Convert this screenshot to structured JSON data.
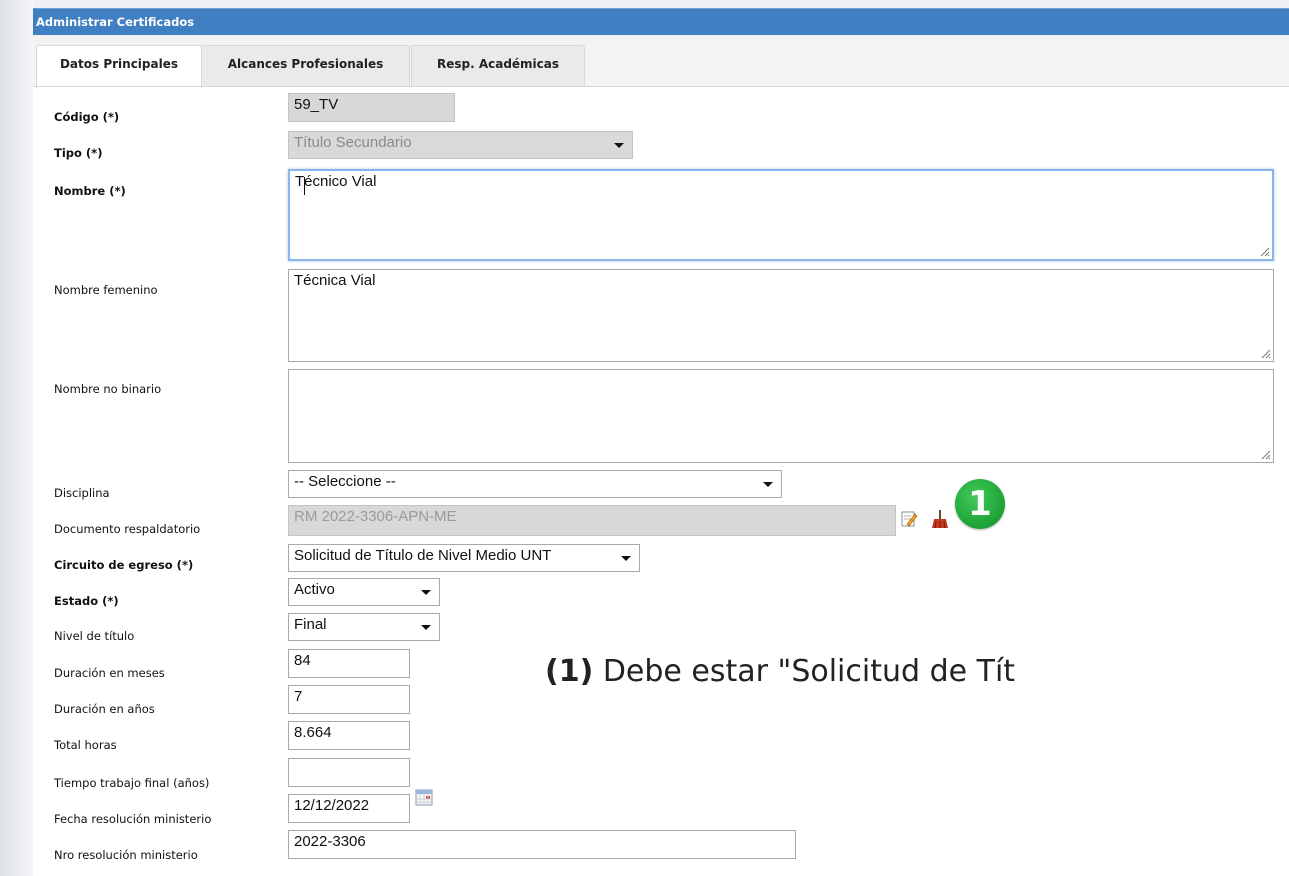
{
  "window": {
    "title": "Administrar Certificados"
  },
  "tabs": [
    {
      "label": "Datos Principales",
      "active": true
    },
    {
      "label": "Alcances Profesionales",
      "active": false
    },
    {
      "label": "Resp. Académicas",
      "active": false
    }
  ],
  "form": {
    "codigo": {
      "label": "Código (*)",
      "value": "59_TV"
    },
    "tipo": {
      "label": "Tipo (*)",
      "value": "Título Secundario"
    },
    "nombre": {
      "label": "Nombre (*)",
      "value": "Técnico Vial"
    },
    "nombre_femenino": {
      "label": "Nombre femenino",
      "value": "Técnica Vial"
    },
    "nombre_no_binario": {
      "label": "Nombre no binario",
      "value": ""
    },
    "disciplina": {
      "label": "Disciplina",
      "value": "-- Seleccione --"
    },
    "documento": {
      "label": "Documento respaldatorio",
      "value": "RM 2022-3306-APN-ME",
      "edit_icon": "edit-icon",
      "clear_icon": "broom-icon"
    },
    "circuito": {
      "label": "Circuito de egreso (*)",
      "value": "Solicitud de Título de Nivel Medio UNT"
    },
    "estado": {
      "label": "Estado (*)",
      "value": "Activo"
    },
    "nivel": {
      "label": "Nivel de título",
      "value": "Final"
    },
    "duracion_meses": {
      "label": "Duración en meses",
      "value": "84"
    },
    "duracion_anios": {
      "label": "Duración en años",
      "value": "7"
    },
    "total_horas": {
      "label": "Total horas",
      "value": "8.664"
    },
    "tiempo_trabajo": {
      "label": "Tiempo trabajo final (años)",
      "value": ""
    },
    "fecha_resolucion": {
      "label": "Fecha resolución ministerio",
      "value": "12/12/2022",
      "icon": "calendar-icon"
    },
    "nro_resolucion": {
      "label": "Nro resolución ministerio",
      "value": "2022-3306"
    }
  },
  "annotation": {
    "badge": "1",
    "number": "(1)",
    "text": " Debe estar \"Solicitud de Tít"
  },
  "colors": {
    "titlebar": "#3f7fc2",
    "badge": "#22a83a"
  }
}
